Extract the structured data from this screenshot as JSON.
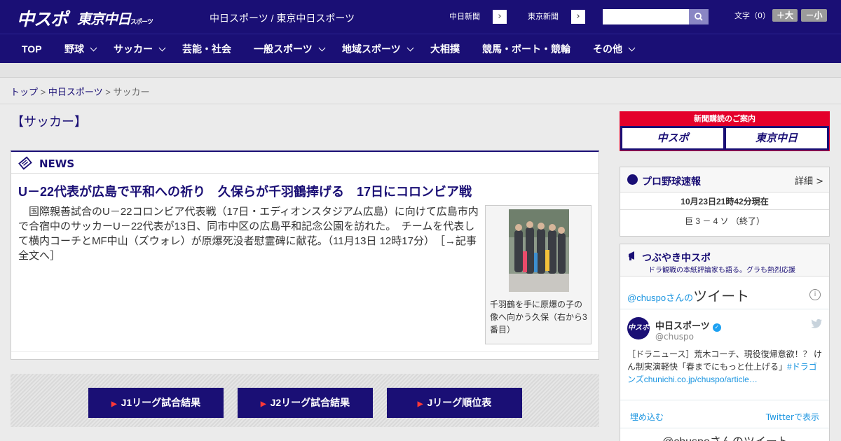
{
  "header": {
    "logo_chuspo": "中スポ",
    "logo_tokyo": "東京中日",
    "logo_tokyo_sub": "スポーツ",
    "site_names": "中日スポーツ / 東京中日スポーツ",
    "chunichi_btn": "中日新聞",
    "tokyo_btn": "東京新聞",
    "search_placeholder": "",
    "fontsize_label": "文字（0）",
    "fontsize_bigger": "＋大",
    "fontsize_smaller": "－小"
  },
  "nav": {
    "items": [
      {
        "label": "TOP"
      },
      {
        "label": "野球"
      },
      {
        "label": "サッカー"
      },
      {
        "label": "芸能・社会"
      },
      {
        "label": "一般スポーツ"
      },
      {
        "label": "地域スポーツ"
      },
      {
        "label": "大相撲"
      },
      {
        "label": "競馬・ボート・競輪"
      },
      {
        "label": "その他"
      }
    ]
  },
  "breadcrumb": {
    "top": "トップ",
    "sep": ">",
    "chuspo": "中日スポーツ",
    "current": "サッカー"
  },
  "page_title": "【サッカー】",
  "news": {
    "section_label": "NEWS",
    "headline": "U－22代表が広島で平和への祈り　久保らが千羽鶴捧げる　17日にコロンビア戦",
    "body": "国際親善試合のU－22コロンビア代表戦（17日・エディオンスタジアム広島）に向けて広島市内で合宿中のサッカーU－22代表が13日、同市中区の広島平和記念公園を訪れた。　チームを代表して横内コーチとMF中山（ズウォレ）が原爆死没者慰霊碑に献花。（11月13日 12時17分）",
    "more": "［→記事全文へ］",
    "photo_caption": "千羽鶴を手に原爆の子の像へ向かう久保（右から3番目）"
  },
  "jleague": {
    "btn1": "J1リーグ試合結果",
    "btn2": "J2リーグ試合結果",
    "btn3": "Jリーグ順位表"
  },
  "sidebar": {
    "subscribe_title": "新聞購読のご案内",
    "subscribe_chuspo": "中スポ",
    "subscribe_tokyo": "東京中日",
    "baseball_title": "プロ野球速報",
    "baseball_detail": "詳細 >",
    "baseball_time": "10月23日21時42分現在",
    "baseball_score": "巨 3 － 4 ソ （終了）",
    "tweets_title": "つぶやき中スポ",
    "tweets_sub": "ドラ観戦の本紙評論家も語る。グラも熱烈応援",
    "tw_title_handle": "@chuspoさんの",
    "tw_title_big": "ツイート",
    "tw_name": "中日スポーツ",
    "tw_handle": "@chuspo",
    "tw_text": "［ドラニュース］荒木コーチ、現役復帰意欲！？ けん制実演軽快「春までにもっと仕上げる」",
    "tw_link": "#ドラゴンズchunichi.co.jp/chuspo/article…",
    "tw_embed": "埋め込む",
    "tw_view": "Twitterで表示",
    "tw_more": "@chuspoさんのツイート"
  },
  "colors": {
    "brand": "#1a0f75",
    "accent_red": "#e4002b",
    "twitter_link": "#1b95e0"
  }
}
